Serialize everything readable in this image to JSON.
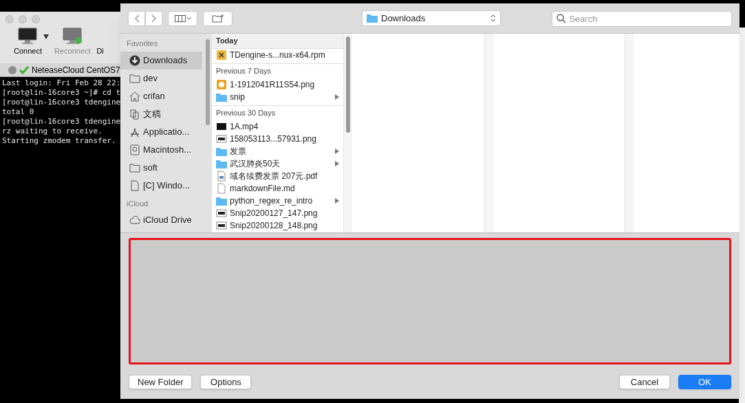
{
  "terminal": {
    "toolbar": [
      {
        "kind": "connect",
        "label": "Connect",
        "disabled": false
      },
      {
        "kind": "reconnect",
        "label": "Reconnect",
        "disabled": true
      },
      {
        "kind": "cut",
        "label": "Di",
        "disabled": false
      }
    ],
    "tab": {
      "label": "NeteaseCloud CentOS7"
    },
    "lines": [
      "Last login: Fri Feb 28 22:",
      "[root@lin-16core3 ~]# cd t",
      "[root@lin-16core3 tdengine",
      "total 0",
      "[root@lin-16core3 tdengine",
      "rz waiting to receive.",
      "Starting zmodem transfer."
    ]
  },
  "dialog": {
    "location": {
      "label": "Downloads"
    },
    "search": {
      "placeholder": "Search"
    },
    "sidebar": [
      {
        "heading": "Favorites",
        "items": [
          {
            "kind": "download",
            "label": "Downloads",
            "selected": true
          },
          {
            "kind": "folder",
            "label": "dev",
            "selected": false
          },
          {
            "kind": "home",
            "label": "crifan",
            "selected": false
          },
          {
            "kind": "docs",
            "label": "文稿",
            "selected": false
          },
          {
            "kind": "apps",
            "label": "Applicatio...",
            "selected": false
          },
          {
            "kind": "disk",
            "label": "Macintosh...",
            "selected": false
          },
          {
            "kind": "folder",
            "label": "soft",
            "selected": false
          },
          {
            "kind": "file",
            "label": "[C] Windo...",
            "selected": false
          }
        ]
      },
      {
        "heading": "iCloud",
        "items": [
          {
            "kind": "cloud",
            "label": "iCloud Drive",
            "selected": false
          }
        ]
      }
    ],
    "groups": [
      {
        "heading": "Today",
        "files": [
          {
            "kind": "package",
            "name": "TDengine-s...nux-x64.rpm",
            "folder": false
          }
        ]
      },
      {
        "heading": "Previous 7 Days",
        "files": [
          {
            "kind": "image",
            "name": "1-1912041R11S54.png",
            "folder": false
          },
          {
            "kind": "folder",
            "name": "snip",
            "folder": true
          }
        ]
      },
      {
        "heading": "Previous 30 Days",
        "files": [
          {
            "kind": "video",
            "name": "1A.mp4",
            "folder": false
          },
          {
            "kind": "shot",
            "name": "158053113...57931.png",
            "folder": false
          },
          {
            "kind": "folder",
            "name": "发票",
            "folder": true
          },
          {
            "kind": "folder",
            "name": "武汉肺炎50天",
            "folder": true
          },
          {
            "kind": "pdf",
            "name": "域名续费发票 207元.pdf",
            "folder": false
          },
          {
            "kind": "doc",
            "name": "markdownFile.md",
            "folder": false
          },
          {
            "kind": "folder",
            "name": "python_regex_re_intro",
            "folder": true
          },
          {
            "kind": "shot",
            "name": "Snip20200127_147.png",
            "folder": false
          },
          {
            "kind": "shot",
            "name": "Snip20200128_148.png",
            "folder": false
          }
        ]
      }
    ],
    "buttons": [
      {
        "label": "New Folder",
        "default": false
      },
      {
        "label": "Options",
        "default": false
      },
      {
        "label": "Cancel",
        "default": false
      },
      {
        "label": "OK",
        "default": true
      }
    ]
  }
}
